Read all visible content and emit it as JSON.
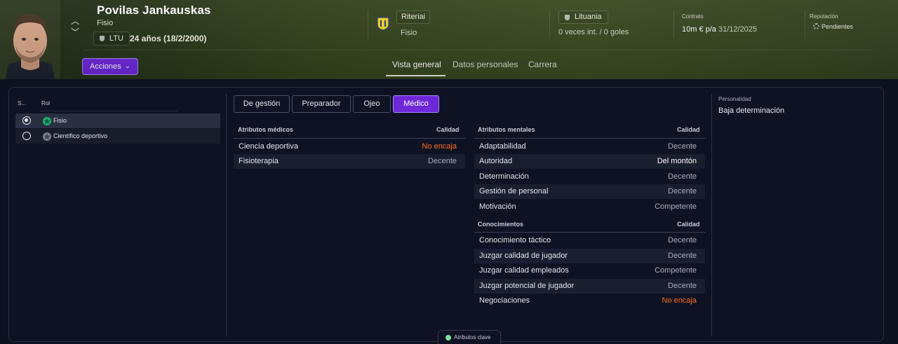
{
  "header": {
    "name": "Povilas Jankauskas",
    "role": "Fisio",
    "nationality_code": "LTU",
    "age": "24 años (18/2/2000)",
    "actions_label": "Acciones",
    "club": {
      "name": "Riteriai",
      "role": "Fisio",
      "crest_colors": [
        "#f4d21f",
        "#1a3b8a"
      ]
    },
    "country": {
      "name": "Lituania",
      "caps": "0 veces int. / 0 goles"
    },
    "contract": {
      "label": "Contrato",
      "value": "10m € p/a",
      "date": "31/12/2025"
    },
    "reputation": {
      "label": "Reputación",
      "value": "Pendientes"
    },
    "tabs": [
      {
        "label": "Vista general",
        "active": true
      },
      {
        "label": "Datos personales",
        "active": false
      },
      {
        "label": "Carrera",
        "active": false
      }
    ]
  },
  "roles_panel": {
    "col_sel": "S...",
    "col_role": "Rol",
    "roles": [
      {
        "label": "Fisio",
        "selected": true,
        "icon": "green-star-icon"
      },
      {
        "label": "Científico deportivo",
        "selected": false,
        "icon": "grey-star-icon"
      }
    ]
  },
  "segments": [
    {
      "label": "De gestión",
      "active": false
    },
    {
      "label": "Preparador",
      "active": false
    },
    {
      "label": "Ojeo",
      "active": false
    },
    {
      "label": "Médico",
      "active": true
    }
  ],
  "medical": {
    "title": "Atributos médicos",
    "quality_header": "Calidad",
    "rows": [
      {
        "label": "Ciencia deportiva",
        "value": "No encaja"
      },
      {
        "label": "Fisioterapia",
        "value": "Decente"
      }
    ]
  },
  "mental": {
    "title": "Atributos mentales",
    "quality_header": "Calidad",
    "rows": [
      {
        "label": "Adaptabilidad",
        "value": "Decente"
      },
      {
        "label": "Autoridad",
        "value": "Del montón"
      },
      {
        "label": "Determinación",
        "value": "Decente"
      },
      {
        "label": "Gestión de personal",
        "value": "Decente"
      },
      {
        "label": "Motivación",
        "value": "Competente"
      }
    ]
  },
  "knowledge": {
    "title": "Conocimientos",
    "quality_header": "Calidad",
    "rows": [
      {
        "label": "Conocimiento táctico",
        "value": "Decente"
      },
      {
        "label": "Juzgar calidad de jugador",
        "value": "Decente"
      },
      {
        "label": "Juzgar calidad empleados",
        "value": "Competente"
      },
      {
        "label": "Juzgar potencial de jugador",
        "value": "Decente"
      },
      {
        "label": "Negociaciones",
        "value": "No encaja"
      }
    ]
  },
  "personality": {
    "label": "Personalidad",
    "value": "Baja determinación"
  },
  "key_attributes_label": "Atributos clave",
  "colors": {
    "accent": "#6d28d9",
    "warning": "#ff6b1a",
    "header_green": "#3c4a22"
  }
}
